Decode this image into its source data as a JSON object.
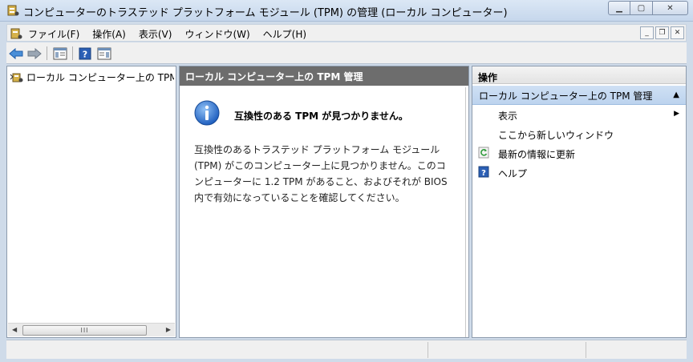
{
  "window": {
    "title": "コンピューターのトラステッド プラットフォーム モジュール (TPM) の管理 (ローカル コンピューター)",
    "minimize_icon": "minimize-icon",
    "maximize_icon": "maximize-icon",
    "close_icon": "close-icon"
  },
  "menubar": {
    "items": [
      {
        "label": "ファイル(F)"
      },
      {
        "label": "操作(A)"
      },
      {
        "label": "表示(V)"
      },
      {
        "label": "ウィンドウ(W)"
      },
      {
        "label": "ヘルプ(H)"
      }
    ]
  },
  "toolbar": {
    "buttons": [
      "back-arrow-icon",
      "forward-arrow-icon",
      "show-hide-console-tree-icon",
      "help-icon",
      "show-hide-action-pane-icon"
    ]
  },
  "tree": {
    "root_label": "ローカル コンピューター上の TPM"
  },
  "center": {
    "header": "ローカル コンピューター上の TPM 管理",
    "headline": "互換性のある TPM が見つかりません。",
    "body": "互換性のあるトラステッド プラットフォーム モジュール (TPM) がこのコンピューター上に見つかりません。このコンピューターに 1.2 TPM があること、およびそれが BIOS 内で有効になっていることを確認してください。"
  },
  "actions": {
    "header": "操作",
    "section_title": "ローカル コンピューター上の TPM 管理",
    "items": [
      {
        "label": "表示",
        "icon": "none",
        "has_submenu": true
      },
      {
        "label": "ここから新しいウィンドウ",
        "icon": "none",
        "has_submenu": false
      },
      {
        "label": "最新の情報に更新",
        "icon": "refresh-icon",
        "has_submenu": false
      },
      {
        "label": "ヘルプ",
        "icon": "help-icon",
        "has_submenu": false
      }
    ]
  },
  "colors": {
    "titlebar": "#c6d7ec",
    "center_header": "#6d6d6d",
    "actions_section": "#bcd3ee",
    "info_icon": "#2a6fc9"
  }
}
